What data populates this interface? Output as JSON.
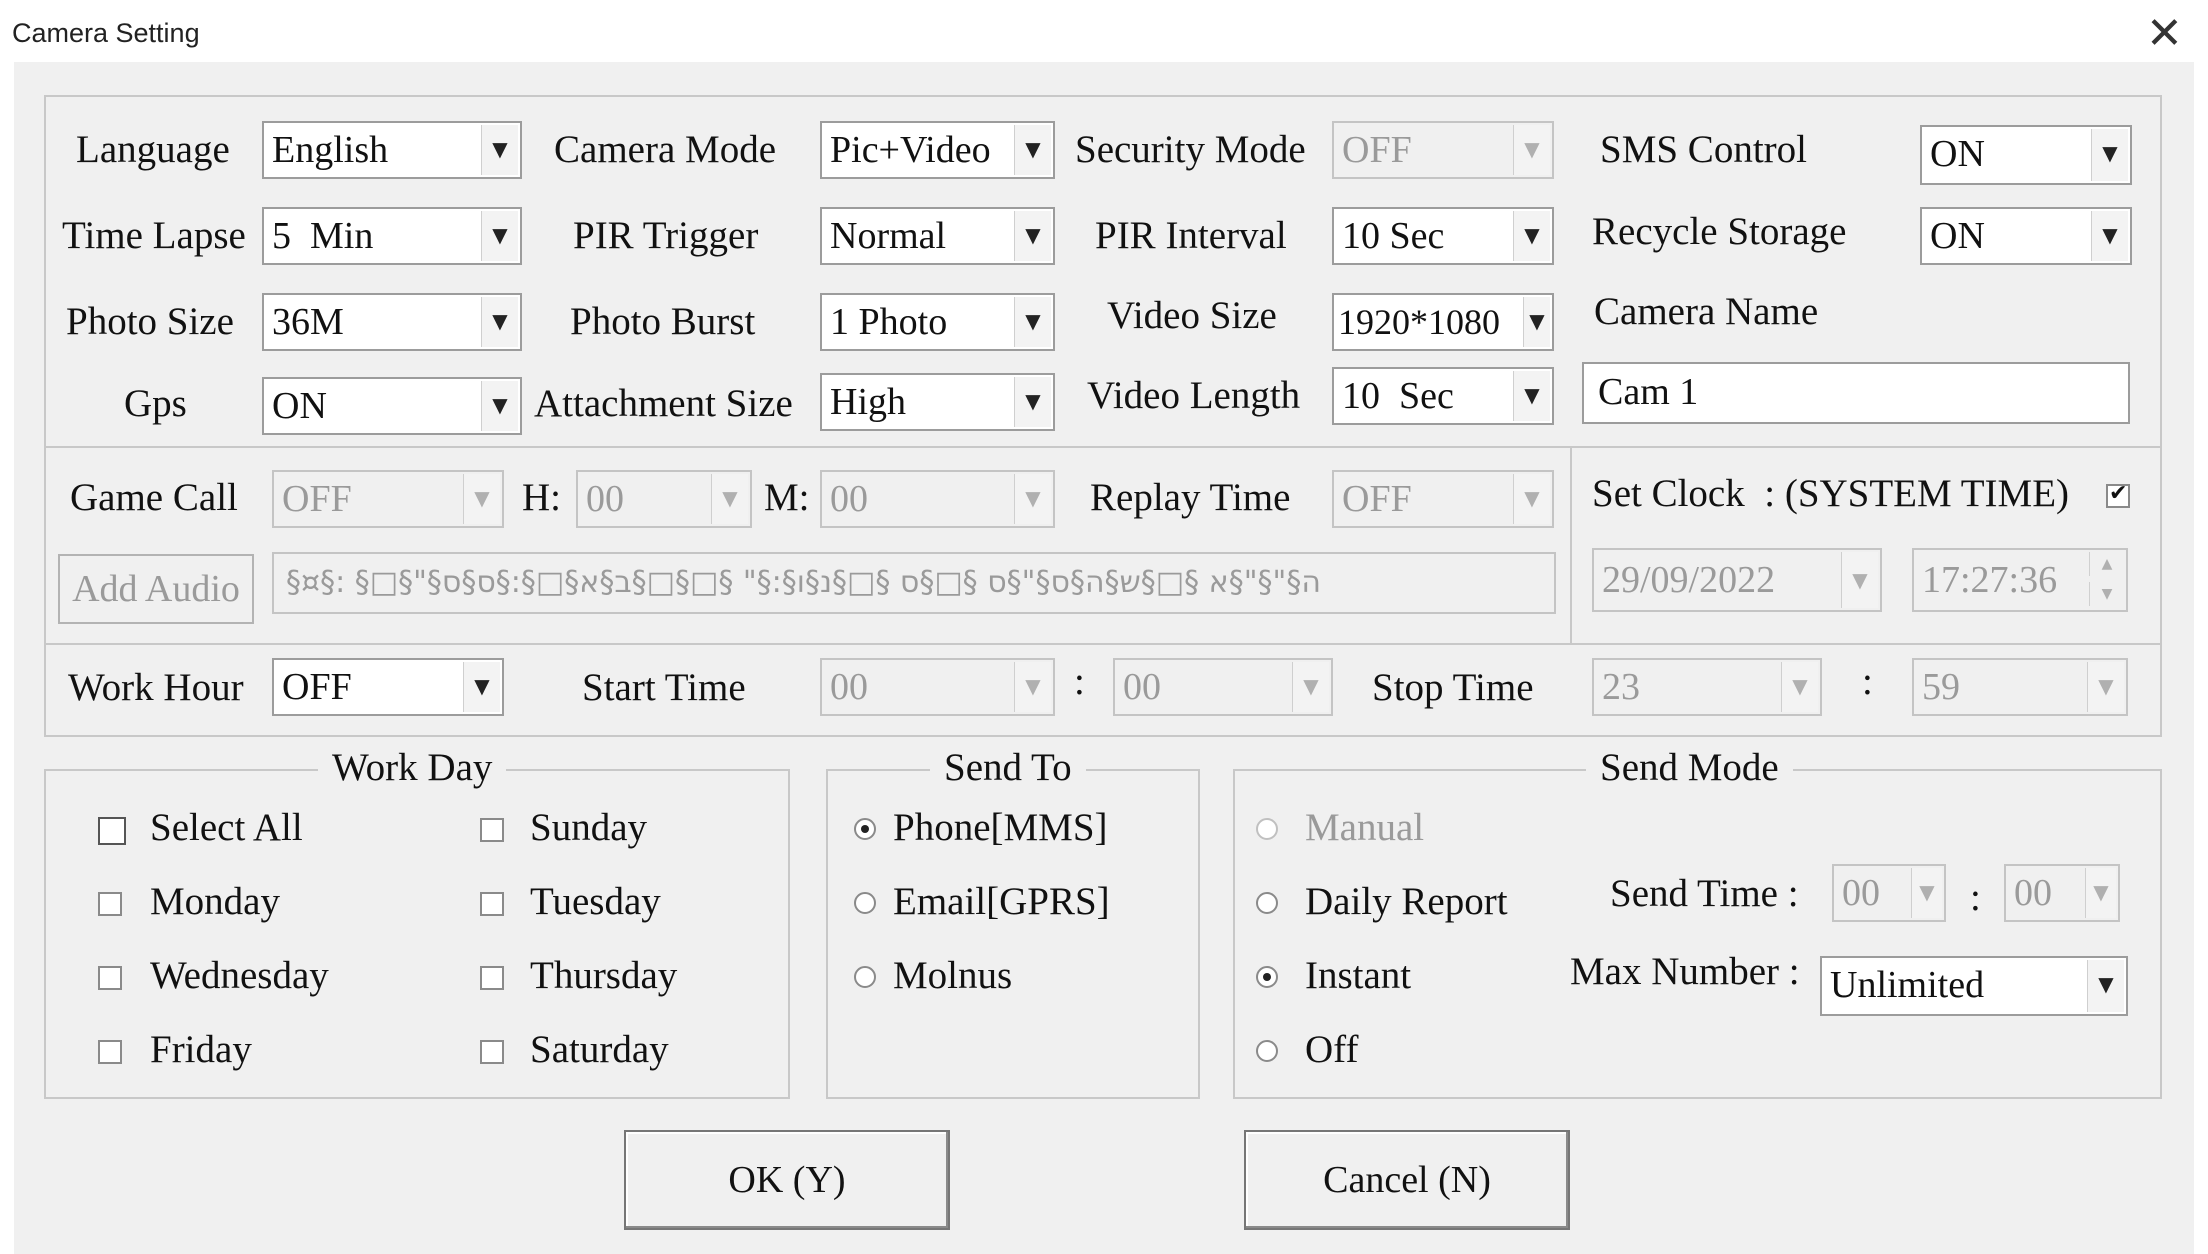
{
  "window": {
    "title": "Camera Setting",
    "close_glyph": "✕"
  },
  "settings": {
    "language": {
      "label": "Language",
      "value": "English"
    },
    "camera_mode": {
      "label": "Camera Mode",
      "value": "Pic+Video"
    },
    "security_mode": {
      "label": "Security Mode",
      "value": "OFF"
    },
    "sms_control": {
      "label": "SMS Control",
      "value": "ON"
    },
    "time_lapse": {
      "label": "Time Lapse",
      "value": "5  Min"
    },
    "pir_trigger": {
      "label": "PIR Trigger",
      "value": "Normal"
    },
    "pir_interval": {
      "label": "PIR Interval",
      "value": "10 Sec"
    },
    "recycle_storage": {
      "label": "Recycle Storage",
      "value": "ON"
    },
    "photo_size": {
      "label": "Photo Size",
      "value": "36M"
    },
    "photo_burst": {
      "label": "Photo Burst",
      "value": "1 Photo"
    },
    "video_size": {
      "label": "Video Size",
      "value": "1920*1080"
    },
    "camera_name": {
      "label": "Camera Name",
      "value": "Cam 1"
    },
    "gps": {
      "label": "Gps",
      "value": "ON"
    },
    "attachment_size": {
      "label": "Attachment Size",
      "value": "High"
    },
    "video_length": {
      "label": "Video Length",
      "value": "10  Sec"
    }
  },
  "game_call": {
    "label": "Game Call",
    "value": "OFF",
    "h_label": "H:",
    "h_value": "00",
    "m_label": "M:",
    "m_value": "00",
    "replay_label": "Replay Time",
    "replay_value": "OFF",
    "add_audio_label": "Add Audio",
    "audio_path": "§¤§: §□§\"§ה§\"§\"§א §□§ש§ה§ס§\"§ס §□§ס §□§נ§ו§:§\" §□§□§ב§א§□§:§ס§ס"
  },
  "clock": {
    "label": "Set Clock  : (SYSTEM TIME)",
    "checked": true,
    "date": "29/09/2022",
    "time": "17:27:36"
  },
  "work_hour": {
    "label": "Work Hour",
    "value": "OFF",
    "start_label": "Start Time",
    "start_h": "00",
    "start_m": "00",
    "stop_label": "Stop Time",
    "stop_h": "23",
    "stop_m": "59",
    "colon": ":"
  },
  "work_day": {
    "legend": "Work Day",
    "select_all": "Select All",
    "days": [
      "Sunday",
      "Monday",
      "Tuesday",
      "Wednesday",
      "Thursday",
      "Friday",
      "Saturday"
    ]
  },
  "send_to": {
    "legend": "Send To",
    "options": [
      "Phone[MMS]",
      "Email[GPRS]",
      "Molnus"
    ],
    "selected": "Phone[MMS]"
  },
  "send_mode": {
    "legend": "Send Mode",
    "options": [
      "Manual",
      "Daily Report",
      "Instant",
      "Off"
    ],
    "selected": "Instant",
    "send_time_label": "Send Time :",
    "send_time_h": "00",
    "send_time_m": "00",
    "max_number_label": "Max Number :",
    "max_number_value": "Unlimited"
  },
  "buttons": {
    "ok": "OK (Y)",
    "cancel": "Cancel (N)"
  }
}
